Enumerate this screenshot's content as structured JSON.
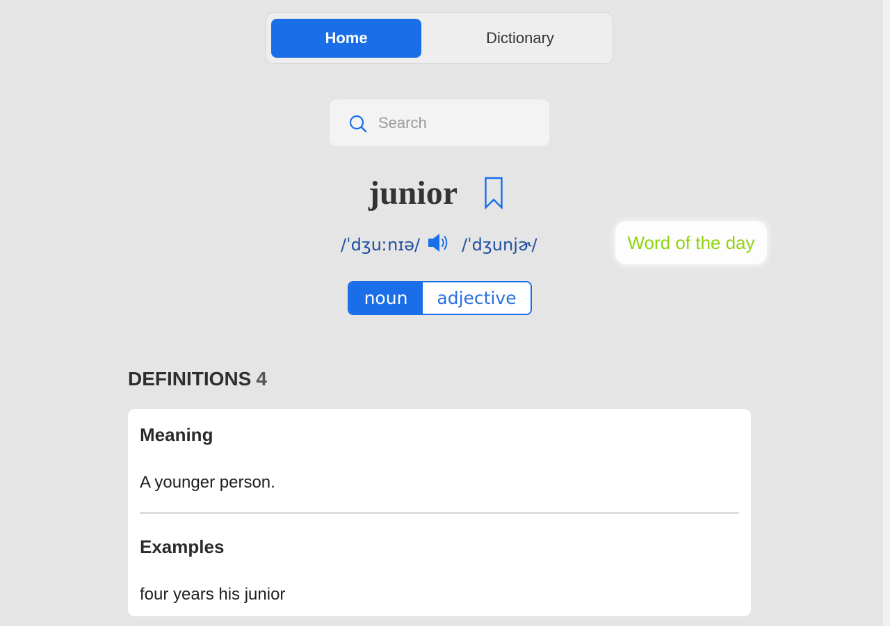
{
  "nav": {
    "tabs": [
      {
        "label": "Home",
        "active": true
      },
      {
        "label": "Dictionary",
        "active": false
      }
    ]
  },
  "search": {
    "placeholder": "Search",
    "icon": "search-icon"
  },
  "word": {
    "text": "junior",
    "bookmark_icon": "bookmark-icon",
    "audio_icon": "speaker-icon",
    "pronunciations": [
      "/ˈdʒuːnɪə/",
      "/ˈdʒunjɚ/"
    ]
  },
  "badge": {
    "label": "Word of the day"
  },
  "parts_of_speech": [
    {
      "label": "noun",
      "selected": true
    },
    {
      "label": "adjective",
      "selected": false
    }
  ],
  "definitions": {
    "heading": "DEFINITIONS",
    "count": "4",
    "items": [
      {
        "meaning_label": "Meaning",
        "meaning": "A younger person.",
        "examples_label": "Examples",
        "example": "four years his junior"
      }
    ]
  },
  "colors": {
    "accent": "#1a6ee8",
    "pronunciation": "#1f4f9f",
    "badge_text": "#8fd40c",
    "page_background": "#e5e5e5"
  }
}
